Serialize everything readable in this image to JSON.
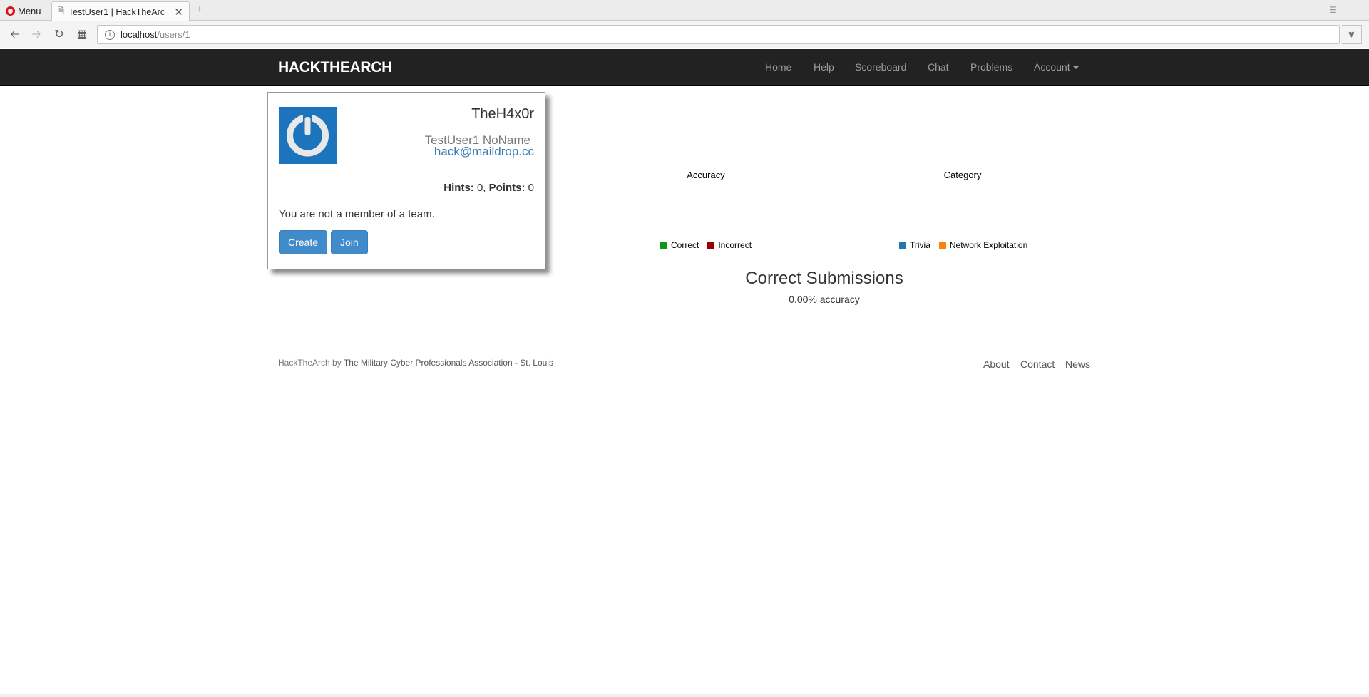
{
  "browser": {
    "menu_label": "Menu",
    "tab_title": "TestUser1 | HackTheArc",
    "url_host": "localhost",
    "url_path": "/users/1"
  },
  "site": {
    "brand": "HACKTHEARCH",
    "nav": {
      "home": "Home",
      "help": "Help",
      "scoreboard": "Scoreboard",
      "chat": "Chat",
      "problems": "Problems",
      "account": "Account"
    }
  },
  "profile": {
    "username": "TheH4x0r",
    "full_name": "TestUser1 NoName",
    "email": "hack@maildrop.cc",
    "hints_label": "Hints:",
    "hints": "0",
    "points_label": "Points:",
    "points": "0",
    "team_message": "You are not a member of a team.",
    "create_button": "Create",
    "join_button": "Join",
    "avatar_color": "#1c75bc"
  },
  "charts": {
    "accuracy": {
      "title": "Accuracy",
      "legend": [
        {
          "label": "Correct",
          "color": "#109618"
        },
        {
          "label": "Incorrect",
          "color": "#990000"
        }
      ]
    },
    "category": {
      "title": "Category",
      "legend": [
        {
          "label": "Trivia",
          "color": "#1f77b4"
        },
        {
          "label": "Network Exploitation",
          "color": "#ff7f0e"
        }
      ]
    }
  },
  "submissions": {
    "title": "Correct Submissions",
    "accuracy_text": "0.00% accuracy"
  },
  "footer": {
    "site_name": "HackTheArch",
    "by": "by",
    "org": "The Military Cyber Professionals Association - St. Louis",
    "about": "About",
    "contact": "Contact",
    "news": "News"
  }
}
